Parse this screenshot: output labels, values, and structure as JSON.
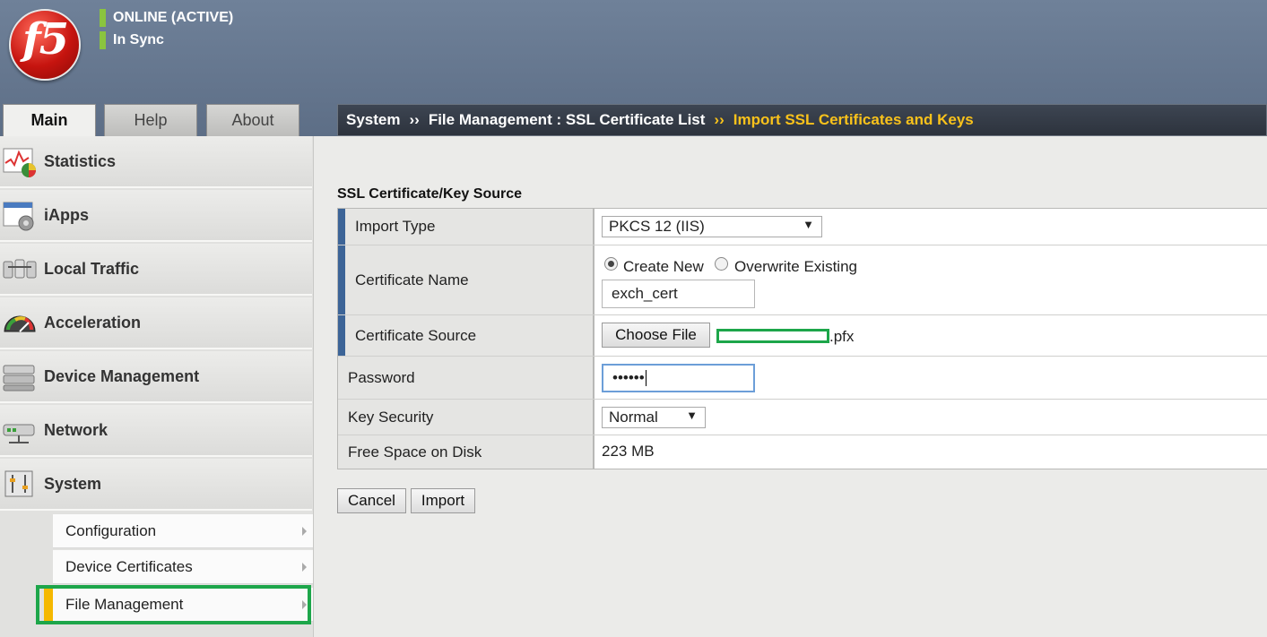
{
  "header": {
    "logo_text": "f5",
    "status_online": "ONLINE (ACTIVE)",
    "status_sync": "In Sync",
    "status_color": "#8ac43f"
  },
  "tabs": [
    {
      "label": "Main",
      "active": true
    },
    {
      "label": "Help",
      "active": false
    },
    {
      "label": "About",
      "active": false
    }
  ],
  "breadcrumb": {
    "crumb1": "System",
    "sep": "››",
    "crumb2": "File Management : SSL Certificate List",
    "current": "Import SSL Certificates and Keys",
    "current_color": "#f9c21b"
  },
  "sidebar": {
    "items": [
      {
        "label": "Statistics",
        "icon": "statistics-icon"
      },
      {
        "label": "iApps",
        "icon": "iapps-icon"
      },
      {
        "label": "Local Traffic",
        "icon": "local-traffic-icon"
      },
      {
        "label": "Acceleration",
        "icon": "acceleration-icon"
      },
      {
        "label": "Device Management",
        "icon": "device-management-icon"
      },
      {
        "label": "Network",
        "icon": "network-icon"
      },
      {
        "label": "System",
        "icon": "system-icon"
      }
    ],
    "subitems": [
      {
        "label": "Configuration"
      },
      {
        "label": "Device Certificates"
      },
      {
        "label": "File Management",
        "active": true
      }
    ]
  },
  "form": {
    "section_title": "SSL Certificate/Key Source",
    "import_type": {
      "label": "Import Type",
      "value": "PKCS 12 (IIS)"
    },
    "certificate_name": {
      "label": "Certificate Name",
      "option_new": "Create New",
      "option_overwrite": "Overwrite Existing",
      "selected": "Create New",
      "value": "exch_cert"
    },
    "certificate_source": {
      "label": "Certificate Source",
      "button": "Choose File",
      "file_suffix": ".pfx"
    },
    "password": {
      "label": "Password",
      "value": "••••••"
    },
    "key_security": {
      "label": "Key Security",
      "value": "Normal"
    },
    "free_space": {
      "label": "Free Space on Disk",
      "value": "223 MB"
    }
  },
  "actions": {
    "cancel": "Cancel",
    "import": "Import"
  }
}
